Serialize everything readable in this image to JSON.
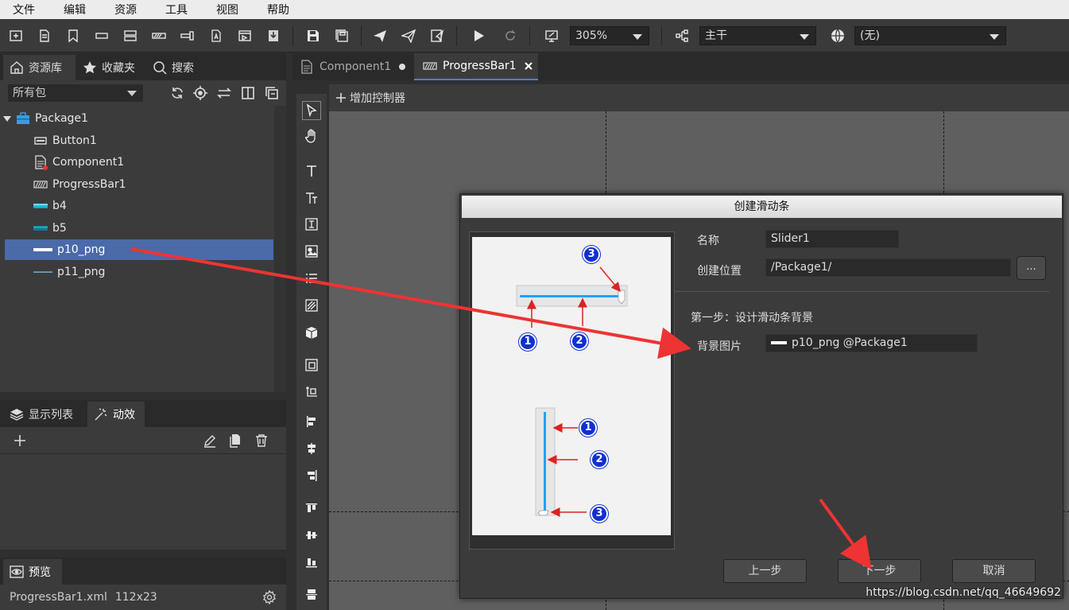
{
  "menu": [
    "文件",
    "编辑",
    "资源",
    "工具",
    "视图",
    "帮助"
  ],
  "toolbar": {
    "zoom": "305%",
    "branch": "主干",
    "language": "(无)"
  },
  "left_tabs": [
    "资源库",
    "收藏夹",
    "搜索"
  ],
  "package_filter": "所有包",
  "tree": {
    "root": "Package1",
    "items": [
      "Button1",
      "Component1",
      "ProgressBar1",
      "b4",
      "b5",
      "p10_png",
      "p11_png"
    ]
  },
  "display_tabs": [
    "显示列表",
    "动效"
  ],
  "preview_tab": "预览",
  "status": {
    "file": "ProgressBar1.xml",
    "size": "112x23"
  },
  "doc_tabs": [
    "Component1",
    "ProgressBar1"
  ],
  "add_control": "增加控制器",
  "dialog": {
    "title": "创建滑动条",
    "name_label": "名称",
    "name_value": "Slider1",
    "location_label": "创建位置",
    "location_value": "/Package1/",
    "browse": "...",
    "step": "第一步：设计滑动条背景",
    "bg_label": "背景图片",
    "bg_value": "p10_png @Package1",
    "prev": "上一步",
    "next": "下一步",
    "cancel": "取消",
    "markers": [
      "1",
      "2",
      "3"
    ]
  },
  "watermark": "https://blog.csdn.net/qq_46649692",
  "colors": {
    "selection": "#4a6aa8",
    "accent_blue": "#1aa3ff",
    "arrow_red": "#ee3333",
    "marker_blue": "#1030d0"
  }
}
